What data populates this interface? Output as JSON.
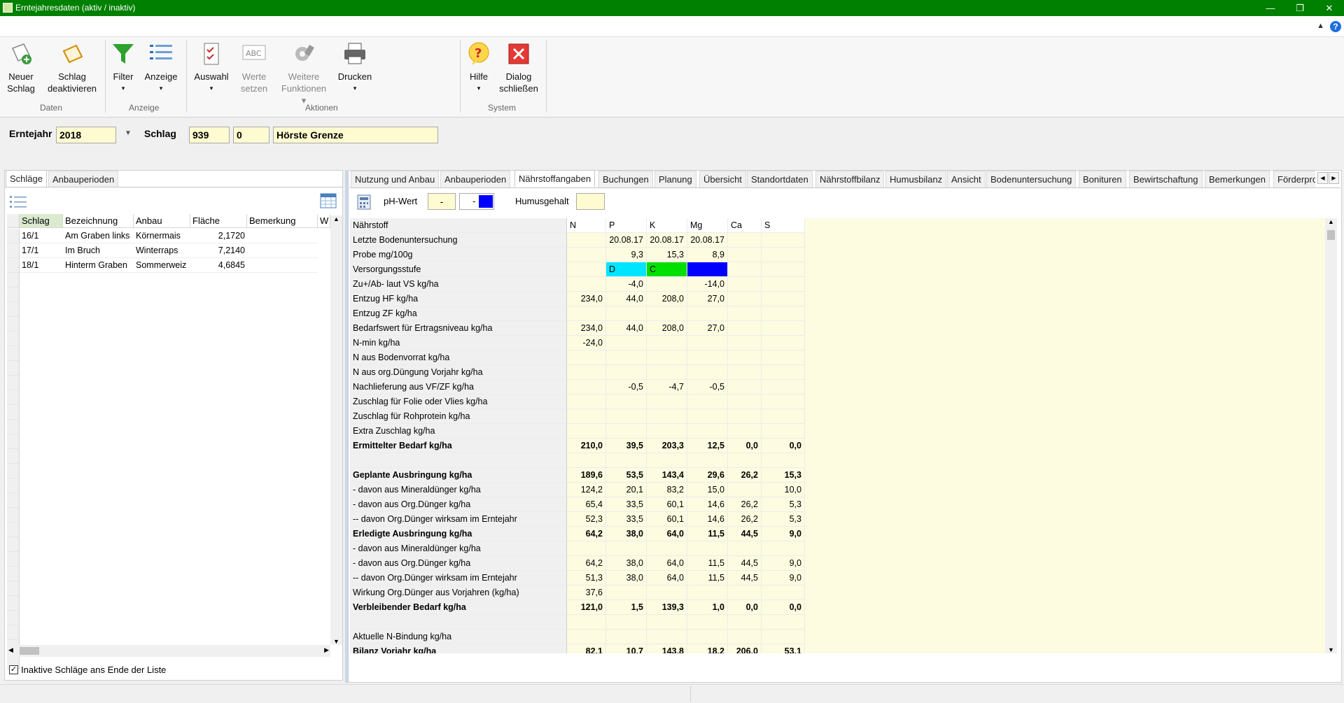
{
  "window": {
    "title": "Erntejahresdaten (aktiv / inaktiv)"
  },
  "ribbon": {
    "buttons": [
      {
        "label1": "Neuer",
        "label2": "Schlag"
      },
      {
        "label1": "Schlag",
        "label2": "deaktivieren"
      },
      {
        "label1": "Filter",
        "label2": "▾"
      },
      {
        "label1": "Anzeige",
        "label2": "▾"
      },
      {
        "label1": "Auswahl",
        "label2": "▾"
      },
      {
        "label1": "Werte",
        "label2": "setzen"
      },
      {
        "label1": "Weitere",
        "label2": "Funktionen ▾"
      },
      {
        "label1": "Drucken",
        "label2": "▾"
      },
      {
        "label1": "Hilfe",
        "label2": "▾"
      },
      {
        "label1": "Dialog",
        "label2": "schließen"
      }
    ],
    "groups": [
      "Daten",
      "Anzeige",
      "Aktionen",
      "System"
    ]
  },
  "header": {
    "erntejahr_label": "Erntejahr",
    "erntejahr_value": "2018",
    "schlag_label": "Schlag",
    "schlag_nr": "939",
    "schlag_sub": "0",
    "schlag_name": "Hörste Grenze"
  },
  "left": {
    "tabs": [
      "Schläge",
      "Anbauperioden"
    ],
    "columns": [
      "Schlag",
      "Bezeichnung",
      "Anbau",
      "Fläche",
      "Bemerkung",
      "W"
    ],
    "rows": [
      [
        "16/1",
        "Am Graben links",
        "Körnermais",
        "2,1720",
        ""
      ],
      [
        "17/1",
        "Im Bruch",
        "Winterraps",
        "7,2140",
        ""
      ],
      [
        "18/1",
        "Hinterm Graben",
        "Sommerweiz",
        "4,6845",
        ""
      ]
    ],
    "checkbox_label": "Inaktive Schläge ans Ende der Liste"
  },
  "right": {
    "tabs": [
      "Nutzung und Anbau",
      "Anbauperioden",
      "Nährstoffangaben",
      "Buchungen",
      "Planung",
      "Übersicht",
      "Standortdaten",
      "Nährstoffbilanz",
      "Humusbilanz",
      "Ansicht",
      "Bodenuntersuchung",
      "Bonituren",
      "Bewirtschaftung",
      "Bemerkungen",
      "Förderprogr"
    ],
    "ph_label": "pH-Wert",
    "ph_value": "-",
    "ph_value2": "-",
    "humus_label": "Humusgehalt",
    "columns": [
      "Nährstoff",
      "N",
      "P",
      "K",
      "Mg",
      "Ca",
      "S"
    ],
    "rows": [
      {
        "n": "Letzte Bodenuntersuchung",
        "v": [
          "",
          "20.08.17",
          "20.08.17",
          "20.08.17",
          "",
          ""
        ],
        "b": false,
        "dates": true
      },
      {
        "n": "Probe mg/100g",
        "v": [
          "",
          "9,3",
          "15,3",
          "8,9",
          "",
          ""
        ],
        "b": false
      },
      {
        "n": "Versorgungsstufe",
        "v": [
          "",
          "D",
          "C",
          "",
          "",
          ""
        ],
        "b": false,
        "vs": true
      },
      {
        "n": "Zu+/Ab- laut VS kg/ha",
        "v": [
          "",
          "-4,0",
          "",
          "-14,0",
          "",
          ""
        ],
        "b": false
      },
      {
        "n": "Entzug HF kg/ha",
        "v": [
          "234,0",
          "44,0",
          "208,0",
          "27,0",
          "",
          ""
        ],
        "b": false
      },
      {
        "n": "Entzug ZF kg/ha",
        "v": [
          "",
          "",
          "",
          "",
          "",
          ""
        ],
        "b": false
      },
      {
        "n": "Bedarfswert für Ertragsniveau kg/ha",
        "v": [
          "234,0",
          "44,0",
          "208,0",
          "27,0",
          "",
          ""
        ],
        "b": false
      },
      {
        "n": "N-min kg/ha",
        "v": [
          "-24,0",
          "",
          "",
          "",
          "",
          ""
        ],
        "b": false
      },
      {
        "n": "N aus Bodenvorrat kg/ha",
        "v": [
          "",
          "",
          "",
          "",
          "",
          ""
        ],
        "b": false
      },
      {
        "n": "N aus org.Düngung Vorjahr kg/ha",
        "v": [
          "",
          "",
          "",
          "",
          "",
          ""
        ],
        "b": false
      },
      {
        "n": "Nachlieferung aus VF/ZF kg/ha",
        "v": [
          "",
          "-0,5",
          "-4,7",
          "-0,5",
          "",
          ""
        ],
        "b": false
      },
      {
        "n": "Zuschlag für Folie oder Vlies kg/ha",
        "v": [
          "",
          "",
          "",
          "",
          "",
          ""
        ],
        "b": false
      },
      {
        "n": "Zuschlag für Rohprotein kg/ha",
        "v": [
          "",
          "",
          "",
          "",
          "",
          ""
        ],
        "b": false
      },
      {
        "n": "Extra Zuschlag kg/ha",
        "v": [
          "",
          "",
          "",
          "",
          "",
          ""
        ],
        "b": false
      },
      {
        "n": "Ermittelter Bedarf kg/ha",
        "v": [
          "210,0",
          "39,5",
          "203,3",
          "12,5",
          "0,0",
          "0,0"
        ],
        "b": true
      },
      {
        "n": "",
        "v": [
          "",
          "",
          "",
          "",
          "",
          ""
        ],
        "b": false
      },
      {
        "n": "Geplante Ausbringung kg/ha",
        "v": [
          "189,6",
          "53,5",
          "143,4",
          "29,6",
          "26,2",
          "15,3"
        ],
        "b": true
      },
      {
        "n": "- davon aus Mineraldünger kg/ha",
        "v": [
          "124,2",
          "20,1",
          "83,2",
          "15,0",
          "",
          "10,0"
        ],
        "b": false
      },
      {
        "n": "- davon aus Org.Dünger kg/ha",
        "v": [
          "65,4",
          "33,5",
          "60,1",
          "14,6",
          "26,2",
          "5,3"
        ],
        "b": false
      },
      {
        "n": "-- davon Org.Dünger wirksam im Erntejahr",
        "v": [
          "52,3",
          "33,5",
          "60,1",
          "14,6",
          "26,2",
          "5,3"
        ],
        "b": false
      },
      {
        "n": "Erledigte Ausbringung kg/ha",
        "v": [
          "64,2",
          "38,0",
          "64,0",
          "11,5",
          "44,5",
          "9,0"
        ],
        "b": true
      },
      {
        "n": "- davon aus Mineraldünger kg/ha",
        "v": [
          "",
          "",
          "",
          "",
          "",
          ""
        ],
        "b": false
      },
      {
        "n": "- davon aus Org.Dünger kg/ha",
        "v": [
          "64,2",
          "38,0",
          "64,0",
          "11,5",
          "44,5",
          "9,0"
        ],
        "b": false
      },
      {
        "n": "-- davon Org.Dünger wirksam im Erntejahr",
        "v": [
          "51,3",
          "38,0",
          "64,0",
          "11,5",
          "44,5",
          "9,0"
        ],
        "b": false
      },
      {
        "n": "Wirkung Org.Dünger aus Vorjahren (kg/ha)",
        "v": [
          "37,6",
          "",
          "",
          "",
          "",
          ""
        ],
        "b": false
      },
      {
        "n": "Verbleibender Bedarf kg/ha",
        "v": [
          "121,0",
          "1,5",
          "139,3",
          "1,0",
          "0,0",
          "0,0"
        ],
        "b": true
      },
      {
        "n": "",
        "v": [
          "",
          "",
          "",
          "",
          "",
          ""
        ],
        "b": false
      },
      {
        "n": "Aktuelle N-Bindung kg/ha",
        "v": [
          "",
          "",
          "",
          "",
          "",
          ""
        ],
        "b": false
      },
      {
        "n": "Bilanz Vorjahr kg/ha",
        "v": [
          "82,1",
          "10,7",
          "143,8",
          "18,2",
          "206,0",
          "53,1"
        ],
        "b": true
      }
    ]
  },
  "colors": {
    "titlebar": "#008000",
    "vs_d": "#00e5ff",
    "vs_c": "#00e000",
    "vs_mg": "#0000ff",
    "grid_bg": "#fdfbe0",
    "input_bg": "#fffbd0"
  }
}
